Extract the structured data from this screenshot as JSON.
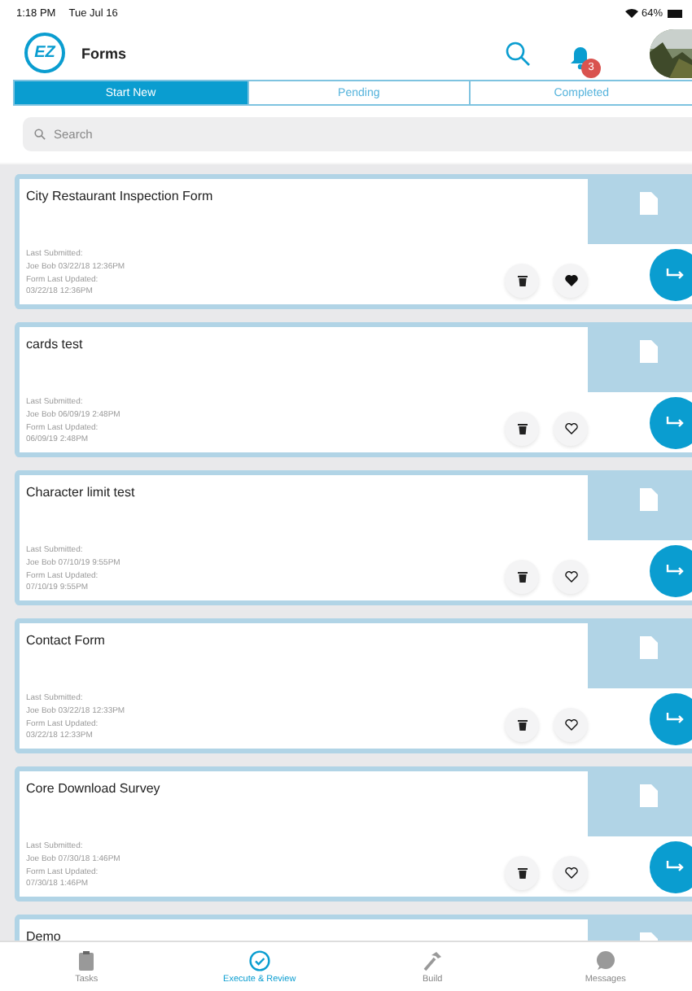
{
  "status_bar": {
    "time": "1:18 PM",
    "date": "Tue Jul 16",
    "battery": "64%"
  },
  "header": {
    "logo": "EZ",
    "title": "Forms",
    "notification_count": "3"
  },
  "tabs": [
    {
      "label": "Start New",
      "selected": true
    },
    {
      "label": "Pending",
      "selected": false
    },
    {
      "label": "Completed",
      "selected": false
    }
  ],
  "search": {
    "placeholder": "Search"
  },
  "forms": [
    {
      "title": "City Restaurant Inspection Form",
      "meta": [
        "Last Submitted:",
        "Joe Bob 03/22/18  12:36PM",
        "Form Last Updated:",
        "03/22/18  12:36PM"
      ],
      "favorite": true
    },
    {
      "title": "cards test",
      "meta": [
        "Last Submitted:",
        "Joe Bob 06/09/19  2:48PM",
        "Form Last Updated:",
        "06/09/19  2:48PM"
      ],
      "favorite": false
    },
    {
      "title": "Character limit test",
      "meta": [
        "Last Submitted:",
        "Joe Bob 07/10/19  9:55PM",
        "Form Last Updated:",
        "07/10/19  9:55PM"
      ],
      "favorite": false
    },
    {
      "title": "Contact Form",
      "meta": [
        "Last Submitted:",
        "Joe Bob 03/22/18  12:33PM",
        "Form Last Updated:",
        "03/22/18  12:33PM"
      ],
      "favorite": false
    },
    {
      "title": "Core Download Survey",
      "meta": [
        "Last Submitted:",
        "Joe Bob 07/30/18  1:46PM",
        "Form Last Updated:",
        "07/30/18  1:46PM"
      ],
      "favorite": false
    },
    {
      "title": "Demo"
    }
  ],
  "bottom_nav": [
    {
      "label": "Tasks",
      "kind": "tasks",
      "selected": false
    },
    {
      "label": "Execute & Review",
      "kind": "execute",
      "selected": true
    },
    {
      "label": "Build",
      "kind": "build",
      "selected": false
    },
    {
      "label": "Messages",
      "kind": "messages",
      "selected": false
    }
  ]
}
